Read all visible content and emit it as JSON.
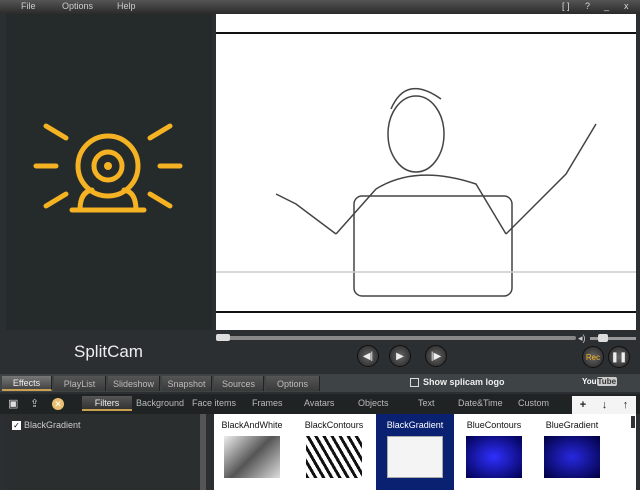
{
  "menu": [
    "File",
    "Options",
    "Help"
  ],
  "window_controls": [
    "[ ]",
    "?",
    "_",
    "x"
  ],
  "brand": {
    "logo_text": "SplitCam",
    "accent": "#f5b324"
  },
  "playback": {
    "seek_fraction": 0.0,
    "volume_fraction": 0.3,
    "prev_icon": "skip-back-icon",
    "play_icon": "play-icon",
    "next_icon": "skip-forward-icon",
    "rec_label": "Rec",
    "pause_icon": "pause-icon"
  },
  "tabs": [
    {
      "label": "Effects",
      "active": true
    },
    {
      "label": "PlayList"
    },
    {
      "label": "Slideshow"
    },
    {
      "label": "Snapshot"
    },
    {
      "label": "Sources"
    },
    {
      "label": "Options"
    }
  ],
  "show_logo": {
    "label": "Show splicam logo",
    "checked": false
  },
  "youtube": {
    "you": "You",
    "tube": "Tube"
  },
  "filter_tabs": [
    "Filters",
    "Background",
    "Face items",
    "Frames",
    "Avatars",
    "Objects",
    "Text",
    "Date&Time",
    "Custom"
  ],
  "arrows": [
    "+",
    "↓",
    "↑"
  ],
  "applied": [
    {
      "label": "BlackGradient",
      "checked": true
    }
  ],
  "filters": [
    {
      "label": "BlackAndWhite"
    },
    {
      "label": "BlackContours"
    },
    {
      "label": "BlackGradient",
      "selected": true
    },
    {
      "label": "BlueContours"
    },
    {
      "label": "BlueGradient"
    }
  ]
}
